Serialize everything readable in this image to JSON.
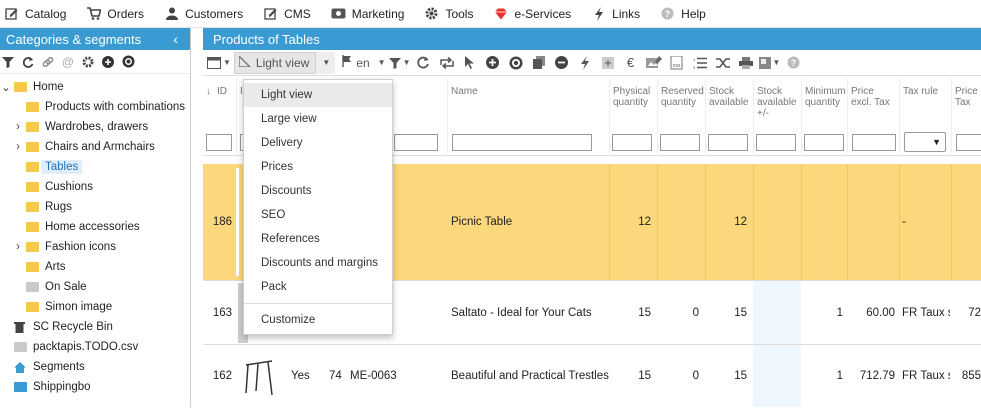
{
  "menu": [
    {
      "icon": "pencil-icon",
      "label": "Catalog"
    },
    {
      "icon": "cart-icon",
      "label": "Orders"
    },
    {
      "icon": "user-icon",
      "label": "Customers"
    },
    {
      "icon": "pencil-icon",
      "label": "CMS"
    },
    {
      "icon": "marketing-icon",
      "label": "Marketing"
    },
    {
      "icon": "gear-icon",
      "label": "Tools"
    },
    {
      "icon": "gem-icon",
      "label": "e-Services"
    },
    {
      "icon": "bolt-icon",
      "label": "Links"
    },
    {
      "icon": "help-icon",
      "label": "Help"
    }
  ],
  "left": {
    "title": "Categories & segments",
    "tree": [
      {
        "label": "Home",
        "arrow": "v",
        "folder": "yellow"
      },
      {
        "label": "Products with combinations",
        "arrow": "",
        "folder": "yellow"
      },
      {
        "label": "Wardrobes, drawers",
        "arrow": ">",
        "folder": "yellow"
      },
      {
        "label": "Chairs and Armchairs",
        "arrow": ">",
        "folder": "yellow"
      },
      {
        "label": "Tables",
        "arrow": "",
        "folder": "yellow",
        "selected": true
      },
      {
        "label": "Cushions",
        "arrow": "",
        "folder": "yellow"
      },
      {
        "label": "Rugs",
        "arrow": "",
        "folder": "yellow"
      },
      {
        "label": "Home accessories",
        "arrow": "",
        "folder": "yellow"
      },
      {
        "label": "Fashion icons",
        "arrow": ">",
        "folder": "yellow"
      },
      {
        "label": "Arts",
        "arrow": "",
        "folder": "yellow"
      },
      {
        "label": "On Sale",
        "arrow": "",
        "folder": "gray"
      },
      {
        "label": "Simon image",
        "arrow": "",
        "folder": "yellow"
      },
      {
        "label": "SC Recycle Bin",
        "arrow": "",
        "folder": "trash"
      },
      {
        "label": "packtapis.TODO.csv",
        "arrow": "",
        "folder": "gray"
      },
      {
        "label": "Segments",
        "arrow": "",
        "folder": "segments"
      },
      {
        "label": "Shippingbo",
        "arrow": "",
        "folder": "blue"
      }
    ]
  },
  "main": {
    "title": "Products of Tables",
    "view_label": "Light view",
    "lang_label": "en",
    "columns": {
      "id": "ID",
      "i": "I",
      "name": "Name",
      "phys": "Physical quantity",
      "reserved": "Reserved quantity",
      "stock": "Stock available",
      "stockpm": "Stock available +/-",
      "min": "Minimum quantity",
      "price": "Price excl. Tax",
      "taxrule": "Tax rule",
      "priceinc": "Price Tax"
    },
    "rows": [
      {
        "id": "186",
        "active": "",
        "n": "",
        "ref": "",
        "name": "Picnic Table",
        "phys": "12",
        "reserved": "",
        "stock": "12",
        "min": "",
        "price": "",
        "taxrule": "-",
        "priceinc": ""
      },
      {
        "id": "163",
        "active": "",
        "n": "",
        "ref": "",
        "name": "Saltato - Ideal for Your Cats",
        "phys": "15",
        "reserved": "0",
        "stock": "15",
        "min": "1",
        "price": "60.00",
        "taxrule": "FR Taux s",
        "priceinc": "72"
      },
      {
        "id": "162",
        "active": "Yes",
        "n": "74",
        "ref": "ME-0063",
        "name": "Beautiful and Practical Trestles",
        "phys": "15",
        "reserved": "0",
        "stock": "15",
        "min": "1",
        "price": "712.79",
        "taxrule": "FR Taux s",
        "priceinc": "855"
      }
    ],
    "dropdown": [
      "Light view",
      "Large view",
      "Delivery",
      "Prices",
      "Discounts",
      "SEO",
      "References",
      "Discounts and margins",
      "Pack"
    ],
    "dropdown_footer": "Customize"
  },
  "colors": {
    "accent": "#3a9bd3",
    "highlight_row": "#fdd77b",
    "stock_col": "#eef7fd"
  }
}
